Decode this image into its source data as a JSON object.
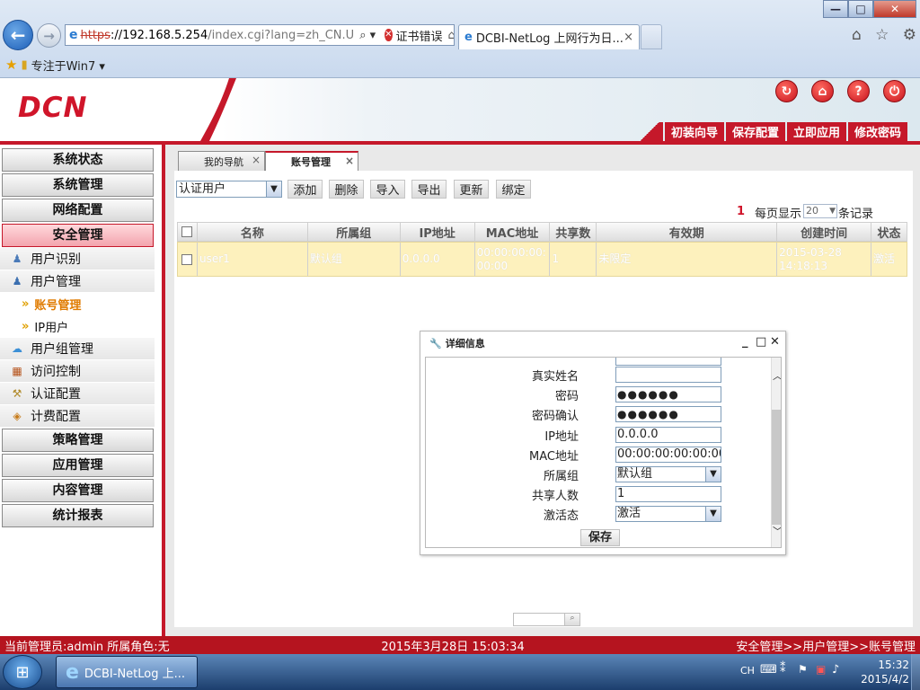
{
  "browser": {
    "address_https": "https",
    "address_host": "://192.168.5.254",
    "address_rest": "/index.cgi?lang=zh_CN.U",
    "address_tools": "⌕ ▾",
    "cert_error": "证书错误",
    "tab_title": "DCBI-NetLog 上网行为日...",
    "tab_close": "×",
    "favorite_folder": "专注于Win7 ▾"
  },
  "app": {
    "logo": "DCN",
    "top_menu": [
      "初装向导",
      "保存配置",
      "立即应用",
      "修改密码"
    ],
    "header_icons": [
      "refresh-icon",
      "home-icon",
      "help-icon",
      "logout-icon"
    ]
  },
  "sidebar": {
    "sections_top": [
      "系统状态",
      "系统管理",
      "网络配置",
      "安全管理"
    ],
    "security_items": [
      {
        "label": "用户识别",
        "icon": "user-id-icon"
      },
      {
        "label": "用户管理",
        "icon": "users-icon"
      }
    ],
    "user_mgmt_sub": [
      {
        "label": "账号管理",
        "selected": true
      },
      {
        "label": "IP用户",
        "selected": false
      }
    ],
    "security_items_2": [
      {
        "label": "用户组管理",
        "icon": "group-icon"
      },
      {
        "label": "访问控制",
        "icon": "wall-icon"
      },
      {
        "label": "认证配置",
        "icon": "auth-icon"
      },
      {
        "label": "计费配置",
        "icon": "billing-icon"
      }
    ],
    "sections_bottom": [
      "策略管理",
      "应用管理",
      "内容管理",
      "统计报表"
    ]
  },
  "tabs": [
    {
      "label": "我的导航",
      "close": "×"
    },
    {
      "label": "账号管理",
      "close": "×"
    }
  ],
  "toolbar": {
    "user_type": "认证用户",
    "buttons": [
      "添加",
      "删除",
      "导入",
      "导出",
      "更新",
      "绑定"
    ]
  },
  "pager": {
    "count": "1",
    "per_page_label": "每页显示",
    "per_page_value": "20",
    "unit": "条记录"
  },
  "table": {
    "columns": [
      "名称",
      "所属组",
      "IP地址",
      "MAC地址",
      "共享数",
      "有效期",
      "创建时间",
      "状态"
    ],
    "rows": [
      {
        "name": "user1",
        "group": "默认组",
        "ip": "0.0.0.0",
        "mac": "00:00:00:00:00:00",
        "share": "1",
        "validity": "未限定",
        "created": "2015-03-28 14:18:13",
        "status": "激活"
      }
    ]
  },
  "dialog": {
    "title": "详细信息",
    "controls": [
      "_",
      "□",
      "✕"
    ],
    "fields": [
      {
        "label": "真实姓名",
        "value": ""
      },
      {
        "label": "密码",
        "value": "●●●●●●"
      },
      {
        "label": "密码确认",
        "value": "●●●●●●"
      },
      {
        "label": "IP地址",
        "value": "0.0.0.0"
      },
      {
        "label": "MAC地址",
        "value": "00:00:00:00:00:00"
      },
      {
        "label": "所属组",
        "value": "默认组"
      },
      {
        "label": "共享人数",
        "value": "1"
      },
      {
        "label": "激活态",
        "value": "激活"
      }
    ],
    "save": "保存"
  },
  "statusbar": {
    "admin": "当前管理员:admin  所属角色:无",
    "datetime": "2015年3月28日 15:03:34",
    "breadcrumb": "安全管理>>用户管理>>账号管理"
  },
  "taskbar": {
    "app_label": "DCBI-NetLog 上...",
    "lang": "CH",
    "time": "15:32",
    "date": "2015/4/2"
  }
}
